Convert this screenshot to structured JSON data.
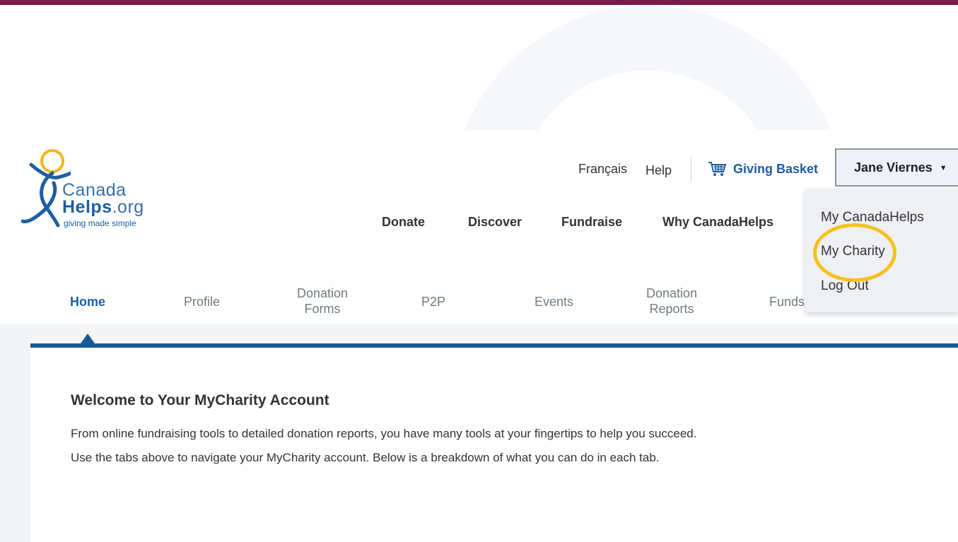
{
  "logo": {
    "word1": "Canada",
    "word2_bold": "Helps",
    "word2_rest": ".org",
    "tagline": "giving made simple"
  },
  "utility_nav": {
    "language": "Français",
    "help": "Help",
    "basket": "Giving Basket",
    "basket_icon": "cart-icon"
  },
  "user_menu": {
    "name": "Jane Viernes",
    "items": [
      "My CanadaHelps",
      "My Charity",
      "Log Out"
    ]
  },
  "main_nav": [
    "Donate",
    "Discover",
    "Fundraise",
    "Why CanadaHelps"
  ],
  "tabs": {
    "home": "Home",
    "profile": "Profile",
    "donation_forms_1": "Donation",
    "donation_forms_2": "Forms",
    "p2p": "P2P",
    "events": "Events",
    "donation_reports_1": "Donation",
    "donation_reports_2": "Reports",
    "funds": "Funds"
  },
  "content": {
    "heading": "Welcome to Your MyCharity Account",
    "line1": "From online fundraising tools to detailed donation reports, you have many tools at your fingertips to help you succeed.",
    "line2": "Use the tabs above to navigate your MyCharity account. Below is a breakdown of what you can do in each tab."
  },
  "colors": {
    "brand_blue": "#1f5ea0",
    "top_bar": "#7d1a45",
    "highlight": "#f4c21b"
  }
}
